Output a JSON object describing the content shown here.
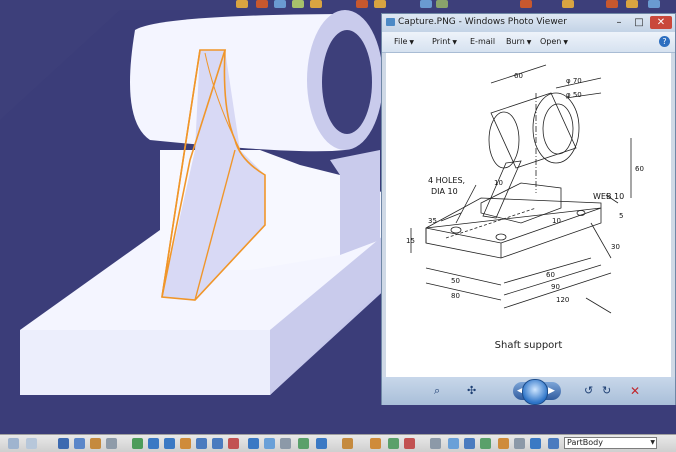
{
  "viewer": {
    "title": "Capture.PNG - Windows Photo Viewer",
    "buttons": {
      "minimize": "–",
      "maximize": "□",
      "close": "✕"
    },
    "menu": [
      {
        "label": "File"
      },
      {
        "label": "Print"
      },
      {
        "label": "E-mail"
      },
      {
        "label": "Burn"
      },
      {
        "label": "Open"
      }
    ],
    "help_label": "?",
    "drawing": {
      "dimensions": {
        "d_60_top": "60",
        "d_phi70": "φ 70",
        "d_phi50": "φ 50",
        "d_60_right": "60",
        "d_10_left": "10",
        "d_10_lower": "10",
        "d_5": "5",
        "d_35": "35",
        "d_15": "15",
        "d_30": "30",
        "d_50": "50",
        "d_80": "80",
        "d_60_bottom": "60",
        "d_90": "90",
        "d_120": "120"
      },
      "labels": {
        "holes_line1": "4 HOLES,",
        "holes_line2": "DIA 10",
        "web": "WEB 10"
      },
      "caption": "Shaft support"
    },
    "controls": {
      "zoom": "⌕",
      "actual_size": "✣",
      "prev": "◀",
      "next": "▶",
      "rotate_ccw": "↺",
      "rotate_cw": "↻",
      "delete": "✕"
    }
  },
  "bottom_toolbar": {
    "part_selector": "PartBody"
  },
  "colors": {
    "background": "#3d3f7a",
    "model_face": "#f4f5ff",
    "model_shade": "#c7c9ec",
    "selection": "#f0962a"
  }
}
